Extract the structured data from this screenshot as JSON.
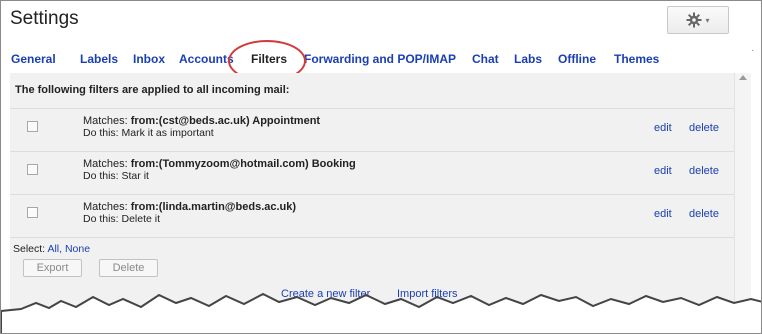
{
  "header": {
    "title": "Settings",
    "gear_icon": "gear-icon",
    "caret": "▾"
  },
  "tabs": [
    {
      "label": "General"
    },
    {
      "label": "Labels"
    },
    {
      "label": "Inbox"
    },
    {
      "label": "Accounts"
    },
    {
      "label": "Filters",
      "active": true
    },
    {
      "label": "Forwarding and POP/IMAP"
    },
    {
      "label": "Chat"
    },
    {
      "label": "Labs"
    },
    {
      "label": "Offline"
    },
    {
      "label": "Themes"
    }
  ],
  "filters": {
    "heading": "The following filters are applied to all incoming mail:",
    "items": [
      {
        "matches_prefix": "Matches: ",
        "matches_value": "from:(cst@beds.ac.uk) Appointment",
        "action": "Do this: Mark it as important",
        "edit": "edit",
        "delete": "delete"
      },
      {
        "matches_prefix": "Matches: ",
        "matches_value": "from:(Tommyzoom@hotmail.com) Booking",
        "action": "Do this: Star it",
        "edit": "edit",
        "delete": "delete"
      },
      {
        "matches_prefix": "Matches: ",
        "matches_value": "from:(linda.martin@beds.ac.uk)",
        "action": "Do this: Delete it",
        "edit": "edit",
        "delete": "delete"
      }
    ],
    "select_label": "Select: ",
    "select_all": "All",
    "select_sep": ", ",
    "select_none": "None",
    "export_button": "Export",
    "delete_button": "Delete",
    "create_link": "Create a new filter",
    "import_link": "Import filters"
  },
  "colors": {
    "link": "#1a3fb3",
    "highlight_circle": "#d23b3b",
    "panel_bg": "#f1f1f1"
  }
}
